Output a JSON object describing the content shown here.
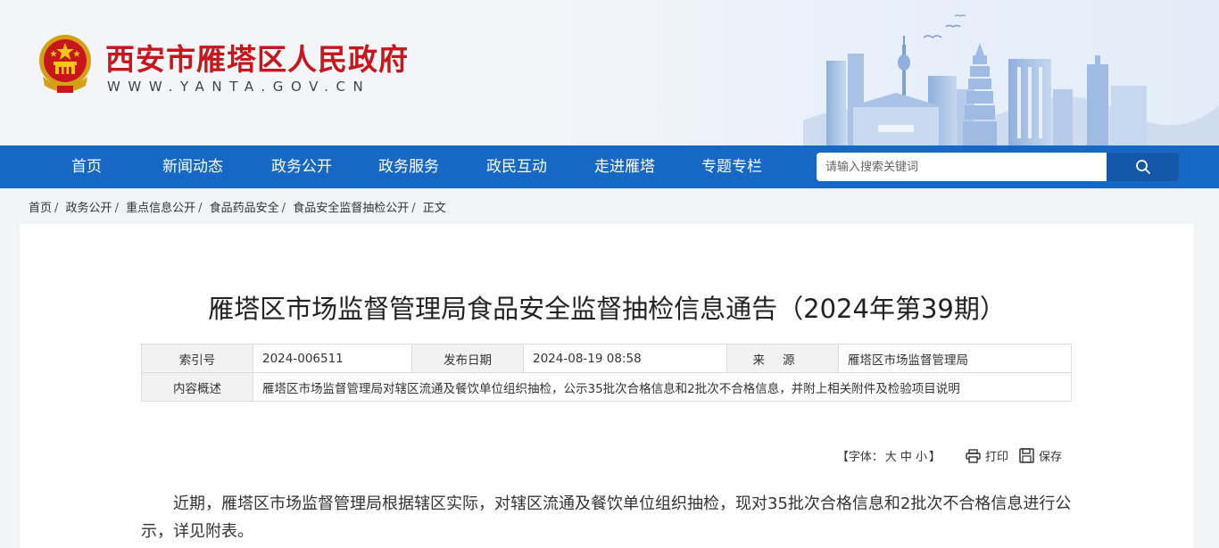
{
  "header": {
    "site_name": "西安市雁塔区人民政府",
    "site_domain": "WWW.YANTA.GOV.CN"
  },
  "nav": {
    "items": [
      {
        "label": "首页"
      },
      {
        "label": "新闻动态"
      },
      {
        "label": "政务公开"
      },
      {
        "label": "政务服务"
      },
      {
        "label": "政民互动"
      },
      {
        "label": "走进雁塔"
      },
      {
        "label": "专题专栏"
      }
    ],
    "search": {
      "placeholder": "请输入搜索关键词"
    }
  },
  "breadcrumb": {
    "items": [
      "首页",
      "政务公开",
      "重点信息公开",
      "食品药品安全",
      "食品安全监督抽检公开",
      "正文"
    ],
    "separator": "/"
  },
  "article": {
    "title": "雁塔区市场监督管理局食品安全监督抽检信息通告（2024年第39期）",
    "meta": {
      "index_label": "索引号",
      "index_value": "2024-006511",
      "date_label": "发布日期",
      "date_value": "2024-08-19 08:58",
      "source_label": "来源",
      "source_value": "雁塔区市场监督管理局",
      "summary_label": "内容概述",
      "summary_value": "雁塔区市场监督管理局对辖区流通及餐饮单位组织抽检，公示35批次合格信息和2批次不合格信息，并附上相关附件及检验项目说明"
    },
    "tools": {
      "font_open": "【字体：",
      "font_large": "大",
      "font_medium": "中",
      "font_small": "小",
      "font_close": "】",
      "print_label": "打印",
      "save_label": "保存"
    },
    "body": "近期，雁塔区市场监督管理局根据辖区实际，对辖区流通及餐饮单位组织抽检，现对35批次合格信息和2批次不合格信息进行公示，详见附表。"
  },
  "colors": {
    "brand_red": "#c8161d",
    "nav_blue": "#1767c4",
    "search_btn": "#1557a8"
  }
}
